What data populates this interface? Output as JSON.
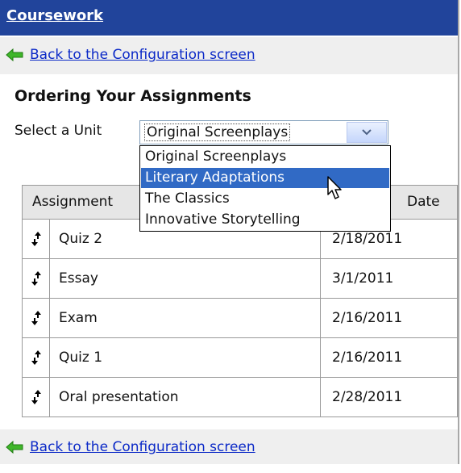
{
  "header": {
    "title": "Coursework"
  },
  "back_link": {
    "label": "Back to the Configuration screen",
    "icon": "green-left-arrow-icon"
  },
  "page": {
    "heading": "Ordering Your Assignments",
    "unit_label": "Select a Unit"
  },
  "unit_select": {
    "value": "Original Screenplays",
    "options": [
      {
        "label": "Original Screenplays",
        "selected": false
      },
      {
        "label": "Literary Adaptations",
        "selected": true
      },
      {
        "label": "The Classics",
        "selected": false
      },
      {
        "label": "Innovative Storytelling",
        "selected": false
      }
    ]
  },
  "table": {
    "headers": {
      "assignment": "Assignment",
      "date": "Date"
    },
    "rows": [
      {
        "name": "Quiz 2",
        "date": "2/18/2011"
      },
      {
        "name": "Essay",
        "date": "3/1/2011"
      },
      {
        "name": "Exam",
        "date": "2/16/2011"
      },
      {
        "name": "Quiz 1",
        "date": "2/16/2011"
      },
      {
        "name": "Oral presentation",
        "date": "2/28/2011"
      }
    ]
  },
  "colors": {
    "title_bar": "#21449b",
    "link": "#0b29c7",
    "selected_option": "#316ac5",
    "toolbar_bg": "#efefef"
  }
}
